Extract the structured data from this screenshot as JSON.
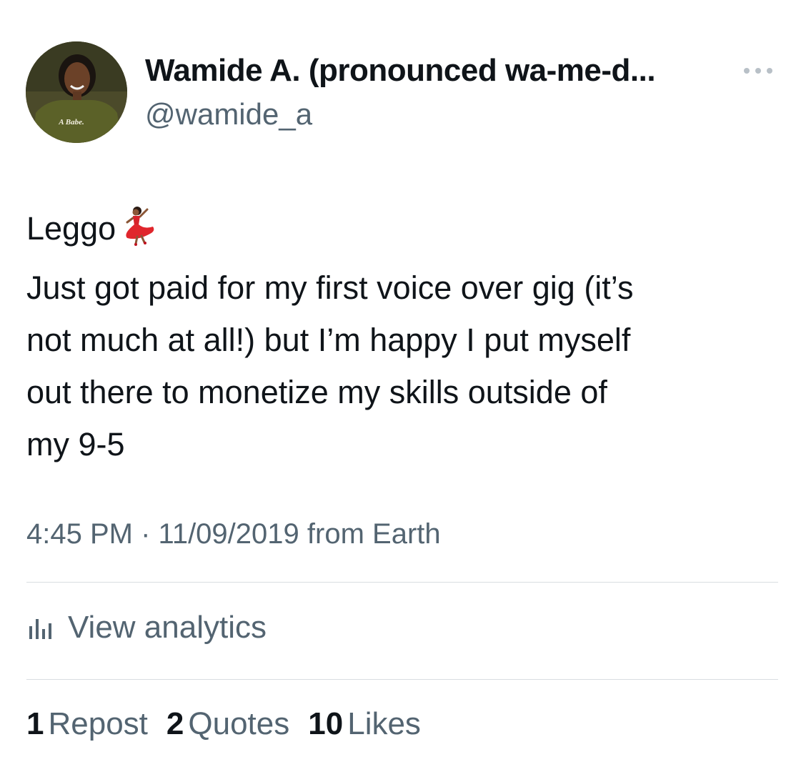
{
  "author": {
    "display_name": "Wamide A. (pronounced wa-me-d...",
    "handle": "@wamide_a",
    "avatar_shirt_text": "A Babe."
  },
  "tweet": {
    "lines": [
      "Leggo",
      "Just got paid for my first voice over gig (it’s",
      "not much at all!) but I’m happy I put myself",
      "out there to monetize my skills outside of",
      "my 9-5"
    ],
    "emoji": "dancer-emoji"
  },
  "meta": {
    "time": "4:45 PM",
    "separator": "·",
    "date": "11/09/2019",
    "source": "from Earth"
  },
  "analytics": {
    "label": "View analytics",
    "icon": "bar-chart-icon"
  },
  "stats": {
    "reposts": {
      "count": "1",
      "label": "Repost"
    },
    "quotes": {
      "count": "2",
      "label": "Quotes"
    },
    "likes": {
      "count": "10",
      "label": "Likes"
    }
  },
  "colors": {
    "text_primary": "#0f1419",
    "text_secondary": "#536471",
    "divider": "#d9dde1"
  }
}
